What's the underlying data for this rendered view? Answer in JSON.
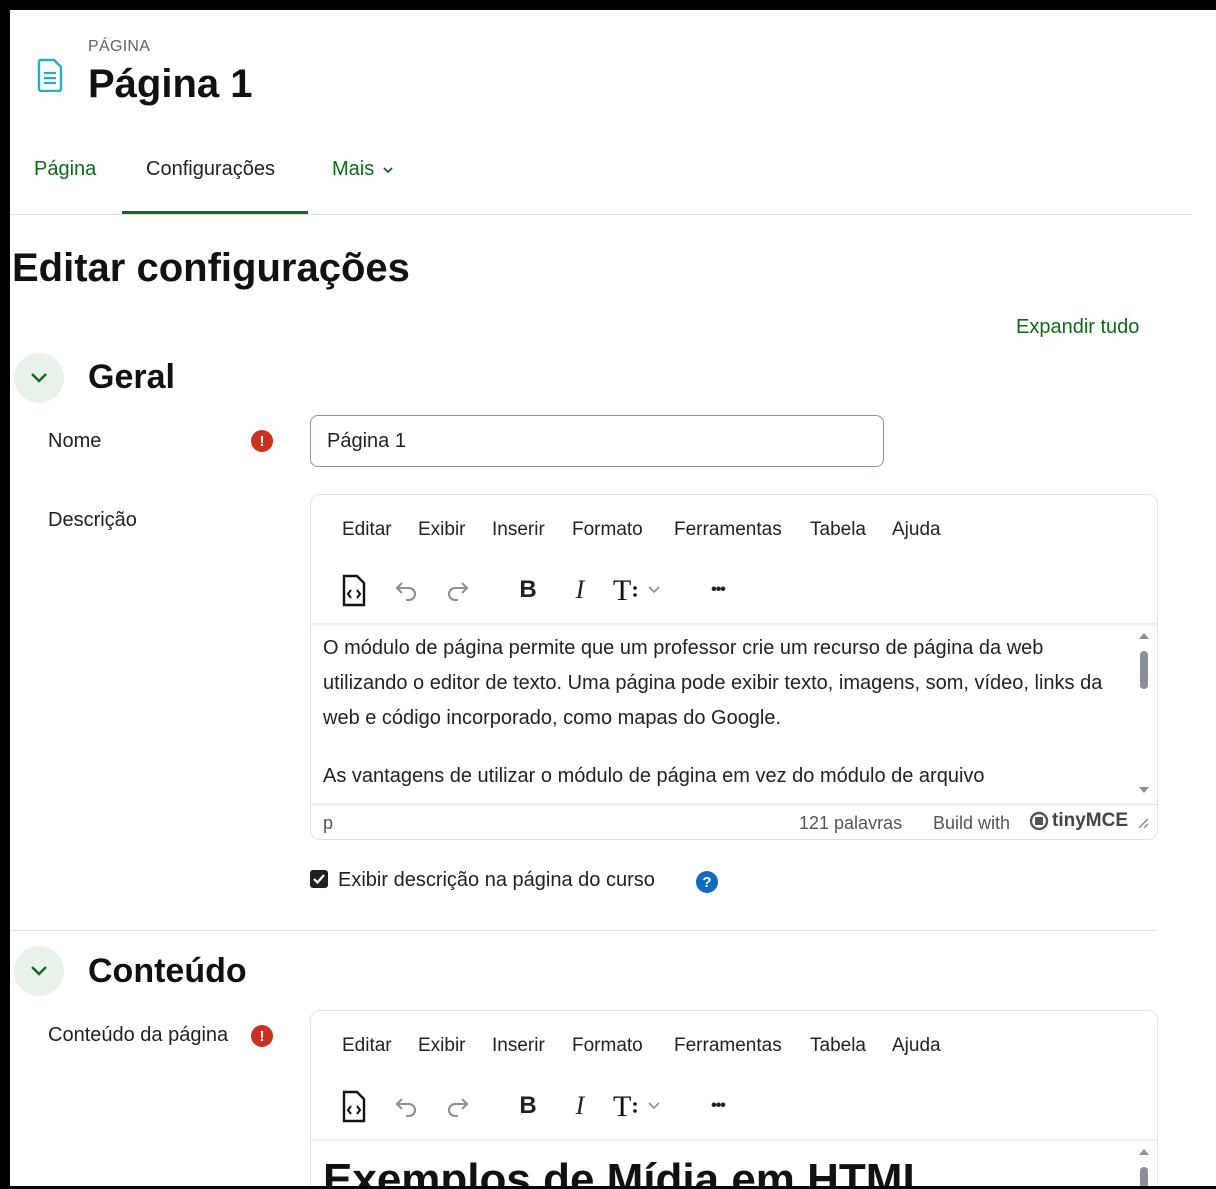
{
  "header": {
    "kicker": "PÁGINA",
    "title": "Página 1"
  },
  "tabs": [
    {
      "label": "Página"
    },
    {
      "label": "Configurações"
    },
    {
      "label": "Mais"
    }
  ],
  "page_heading": "Editar configurações",
  "expand_all": "Expandir tudo",
  "sections": {
    "geral": {
      "title": "Geral",
      "nome_label": "Nome",
      "nome_value": "Página 1",
      "descricao_label": "Descrição",
      "descricao_paragraphs": [
        "O módulo de página permite que um professor crie um recurso de página da web utilizando o editor de texto. Uma página pode exibir texto, imagens, som, vídeo, links da web e código incorporado, como mapas do Google.",
        "As vantagens de utilizar o módulo de página em vez do módulo de arquivo"
      ],
      "status_path": "p",
      "word_count": "121 palavras",
      "build_with": "Build with",
      "brand": "tinyMCE",
      "show_desc_label": "Exibir descrição na página do curso"
    },
    "conteudo": {
      "title": "Conteúdo",
      "label": "Conteúdo da página",
      "visible_heading": "Exemplos de Mídia em HTML"
    }
  },
  "editor_menu": [
    "Editar",
    "Exibir",
    "Inserir",
    "Formato",
    "Ferramentas",
    "Tabela",
    "Ajuda"
  ],
  "toolbar": {
    "bold": "B",
    "italic": "I",
    "more": "•••"
  },
  "icons": {
    "page": "file-text-icon",
    "required": "exclamation-circle-icon",
    "help": "question-circle-icon",
    "collapse": "chevron-down-icon"
  },
  "colors": {
    "accent": "#0f6a1a",
    "required": "#ca3120",
    "help": "#0f6cbf",
    "page_icon": "#1eb0c8"
  }
}
